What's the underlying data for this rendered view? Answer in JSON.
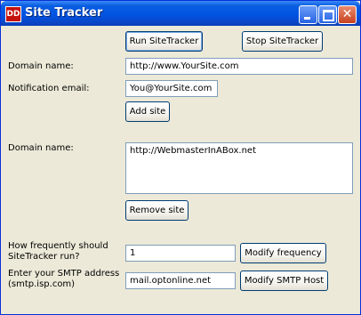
{
  "window": {
    "title": "Site Tracker"
  },
  "toolbar": {
    "run_label": "Run SiteTracker",
    "stop_label": "Stop SiteTracker"
  },
  "add_section": {
    "domain_label": "Domain name:",
    "domain_value": "http://www.YourSite.com",
    "email_label": "Notification email:",
    "email_value": "You@YourSite.com",
    "add_label": "Add site"
  },
  "list_section": {
    "domain_label": "Domain name:",
    "sites": [
      "http://WebmasterInABox.net"
    ],
    "remove_label": "Remove site"
  },
  "frequency": {
    "label_line1": "How frequently should",
    "label_line2": "SiteTracker run?",
    "value": "1",
    "button_label": "Modify frequency"
  },
  "smtp": {
    "label_line1": "Enter your SMTP address",
    "label_line2": "(smtp.isp.com)",
    "value": "mail.optonline.net",
    "button_label": "Modify SMTP Host"
  }
}
